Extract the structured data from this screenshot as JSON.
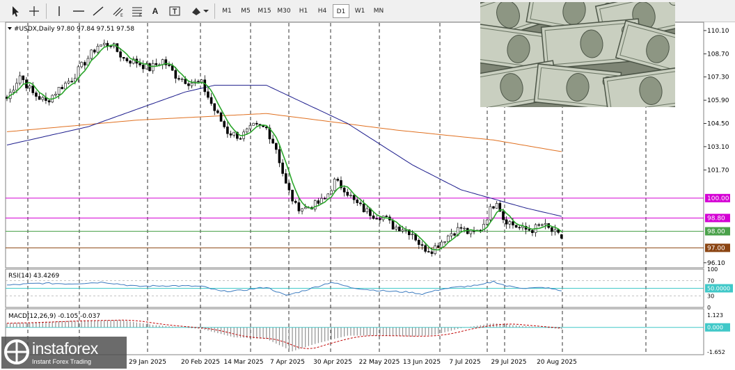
{
  "toolbar": {
    "tools": [
      {
        "name": "cursor-icon"
      },
      {
        "name": "crosshair-icon"
      },
      {
        "name": "vertical-line-icon"
      },
      {
        "name": "horizontal-line-icon"
      },
      {
        "name": "trendline-icon"
      },
      {
        "name": "channel-icon"
      },
      {
        "name": "fibonacci-icon"
      },
      {
        "name": "text-icon"
      },
      {
        "name": "text-label-icon"
      },
      {
        "name": "shapes-icon"
      }
    ],
    "text_tool_label": "A",
    "timeframes": [
      "M1",
      "M5",
      "M15",
      "M30",
      "H1",
      "H4",
      "D1",
      "W1",
      "MN"
    ],
    "active_timeframe": "D1"
  },
  "chart_data": [
    {
      "type": "candlestick",
      "symbol_header": "#USDX,Daily  97.80 97.84 97.51 97.58",
      "ohlc": {
        "open": 97.8,
        "high": 97.84,
        "low": 97.51,
        "close": 97.58
      },
      "ylim": [
        95.8,
        110.6
      ],
      "y_ticks": [
        110.1,
        108.7,
        107.3,
        105.9,
        104.5,
        103.1,
        101.7,
        96.1
      ],
      "y_tick_labels": [
        "110.10",
        "108.70",
        "107.30",
        "105.90",
        "104.50",
        "103.10",
        "101.70",
        "96.10"
      ],
      "x_labels": [
        "29 Jan 2025",
        "20 Feb 2025",
        "14 Mar 2025",
        "7 Apr 2025",
        "30 Apr 2025",
        "22 May 2025",
        "13 Jun 2025",
        "7 Jul 2025",
        "29 Jul 2025",
        "20 Aug 2025"
      ],
      "price_anchors": [
        [
          0,
          106.0
        ],
        [
          4,
          107.4
        ],
        [
          8,
          106.3
        ],
        [
          12,
          105.8
        ],
        [
          16,
          106.6
        ],
        [
          20,
          107.2
        ],
        [
          24,
          108.2
        ],
        [
          28,
          109.2
        ],
        [
          32,
          109.3
        ],
        [
          36,
          108.4
        ],
        [
          40,
          108.2
        ],
        [
          44,
          107.8
        ],
        [
          48,
          108.3
        ],
        [
          52,
          107.4
        ],
        [
          56,
          107.0
        ],
        [
          60,
          106.9
        ],
        [
          64,
          105.3
        ],
        [
          68,
          104.0
        ],
        [
          72,
          103.7
        ],
        [
          76,
          104.3
        ],
        [
          80,
          104.2
        ],
        [
          83,
          103.0
        ],
        [
          86,
          100.8
        ],
        [
          89,
          99.5
        ],
        [
          92,
          99.4
        ],
        [
          95,
          99.6
        ],
        [
          98,
          99.9
        ],
        [
          101,
          101.0
        ],
        [
          104,
          100.6
        ],
        [
          107,
          99.8
        ],
        [
          110,
          99.3
        ],
        [
          113,
          99.0
        ],
        [
          116,
          98.9
        ],
        [
          119,
          98.3
        ],
        [
          122,
          98.2
        ],
        [
          125,
          97.9
        ],
        [
          128,
          97.0
        ],
        [
          131,
          96.9
        ],
        [
          134,
          97.4
        ],
        [
          137,
          97.9
        ],
        [
          140,
          98.2
        ],
        [
          143,
          97.8
        ],
        [
          146,
          98.1
        ],
        [
          149,
          99.3
        ],
        [
          151,
          99.9
        ],
        [
          153,
          98.8
        ],
        [
          156,
          98.4
        ],
        [
          159,
          98.1
        ],
        [
          162,
          98.1
        ],
        [
          165,
          98.4
        ],
        [
          168,
          98.0
        ],
        [
          171,
          97.6
        ]
      ],
      "horizontal_levels": [
        {
          "value": 100.0,
          "label": "100.00",
          "color": "#d400d4"
        },
        {
          "value": 98.8,
          "label": "98.80",
          "color": "#d400d4"
        },
        {
          "value": 98.0,
          "label": "98.00",
          "color": "#4aa14a"
        },
        {
          "value": 97.0,
          "label": "97.00",
          "color": "#8b4513"
        }
      ],
      "ma_fast_color": "#2aa52a",
      "ma_mid_color": "#1c1c8c",
      "ma_slow_color": "#e07020"
    },
    {
      "type": "line",
      "indicator_label": "RSI(14) 43.4269",
      "ylim": [
        0,
        100
      ],
      "y_tick_labels": [
        "100",
        "70",
        "50.0000",
        "30",
        "0"
      ],
      "level_labels": {
        "overbought": "70",
        "oversold": "30"
      },
      "current_label": "50.0000",
      "anchors": [
        [
          0,
          58
        ],
        [
          10,
          63
        ],
        [
          20,
          62
        ],
        [
          30,
          66
        ],
        [
          40,
          55
        ],
        [
          50,
          57
        ],
        [
          60,
          55
        ],
        [
          66,
          42
        ],
        [
          72,
          44
        ],
        [
          80,
          53
        ],
        [
          86,
          31
        ],
        [
          92,
          45
        ],
        [
          100,
          66
        ],
        [
          106,
          52
        ],
        [
          112,
          46
        ],
        [
          118,
          42
        ],
        [
          124,
          40
        ],
        [
          128,
          35
        ],
        [
          134,
          48
        ],
        [
          140,
          54
        ],
        [
          146,
          58
        ],
        [
          150,
          68
        ],
        [
          154,
          56
        ],
        [
          160,
          50
        ],
        [
          166,
          52
        ],
        [
          171,
          43
        ]
      ],
      "color": "#3a7abf"
    },
    {
      "type": "bar",
      "indicator_label": "MACD(12,26,9) -0.105 -0.037",
      "ylim": [
        -1.652,
        1.123
      ],
      "y_tick_labels": [
        "1.123",
        "0.000",
        "-1.652"
      ],
      "current_label": "0.000",
      "anchors": [
        [
          0,
          0.25
        ],
        [
          20,
          0.4
        ],
        [
          35,
          0.45
        ],
        [
          45,
          0.15
        ],
        [
          60,
          -0.1
        ],
        [
          70,
          -0.6
        ],
        [
          80,
          -0.7
        ],
        [
          88,
          -1.45
        ],
        [
          95,
          -1.0
        ],
        [
          105,
          -0.5
        ],
        [
          115,
          -0.5
        ],
        [
          125,
          -0.55
        ],
        [
          132,
          -0.45
        ],
        [
          140,
          -0.05
        ],
        [
          150,
          0.25
        ],
        [
          158,
          0.1
        ],
        [
          171,
          -0.1
        ]
      ],
      "signal_color": "#c00000",
      "hist_color": "#909090"
    }
  ],
  "branding": {
    "logo_text": "instaforex",
    "tagline": "Instant Forex Trading"
  }
}
